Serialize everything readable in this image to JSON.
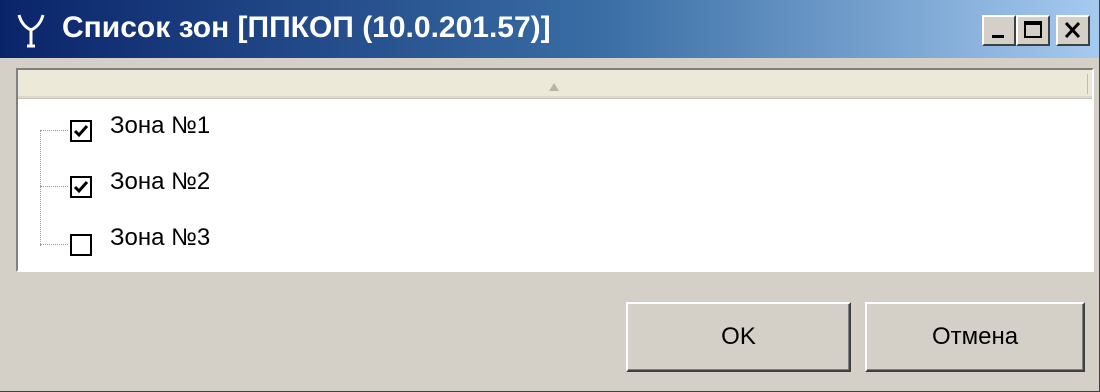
{
  "window": {
    "title": "Список зон [ППКОП (10.0.201.57)]",
    "icon": "antenna-app-icon",
    "caption_buttons": [
      "minimize-icon",
      "maximize-icon",
      "close-icon"
    ]
  },
  "list": {
    "header_sort": "ascending",
    "items": [
      {
        "label": "Зона №1",
        "checked": true
      },
      {
        "label": "Зона №2",
        "checked": true
      },
      {
        "label": "Зона №3",
        "checked": false
      }
    ]
  },
  "buttons": {
    "ok_label": "OK",
    "cancel_label": "Отмена"
  },
  "colors": {
    "title_gradient_start": "#0a246a",
    "title_gradient_end": "#a6caf0",
    "window_face": "#d4d0c8"
  }
}
